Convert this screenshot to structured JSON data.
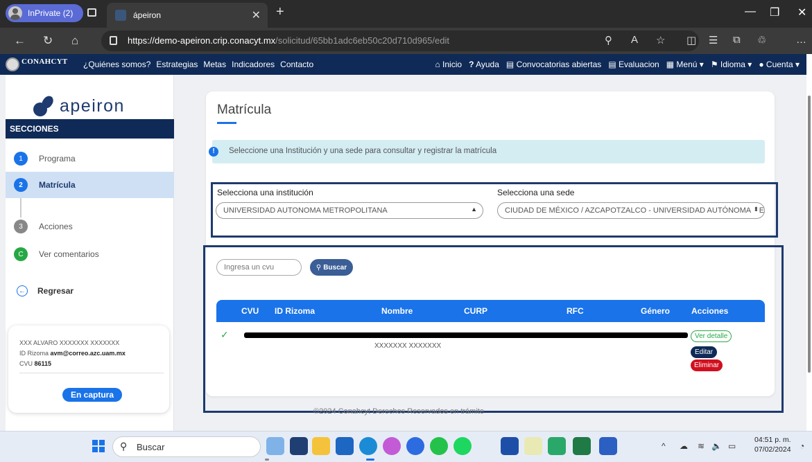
{
  "browser": {
    "inprivate_label": "InPrivate (2)",
    "tab_title": "ápeiron",
    "url_host": "https://demo-apeiron.crip.conacyt.mx",
    "url_path": "/solicitud/65bb1adc6eb50c20d710d965/edit"
  },
  "site_nav": {
    "logo_text": "CONAHCYT",
    "links": [
      "¿Quiénes somos?",
      "Estrategias",
      "Metas",
      "Indicadores",
      "Contacto"
    ],
    "right": [
      "Inicio",
      "Ayuda",
      "Convocatorias abiertas",
      "Evaluacion",
      "Menú",
      "Idioma",
      "Cuenta"
    ]
  },
  "sidebar": {
    "brand": "apeiron",
    "section_header": "SECCIONES",
    "steps": [
      {
        "num": "1",
        "label": "Programa"
      },
      {
        "num": "2",
        "label": "Matrícula"
      },
      {
        "num": "3",
        "label": "Acciones"
      },
      {
        "num": "C",
        "label": "Ver comentarios"
      }
    ],
    "back_label": "Regresar",
    "user": {
      "name": "XXX ALVARO XXXXXXX XXXXXXX",
      "rizoma_label": "ID Rizoma",
      "rizoma_value": "avm@correo.azc.uam.mx",
      "cvu_label": "CVU",
      "cvu_value": "86115",
      "status": "En captura"
    }
  },
  "main": {
    "title": "Matrícula",
    "alert": "Seleccione una Institución y una sede para consultar y registrar la matrícula",
    "institution_label": "Selecciona una institución",
    "institution_value": "UNIVERSIDAD AUTONOMA METROPOLITANA",
    "sede_label": "Selecciona una sede",
    "sede_value": "CIUDAD DE MÉXICO / AZCAPOTZALCO - UNIVERSIDAD AUTÓNOMA METROPOLITANA",
    "cvu_placeholder": "Ingresa un cvu",
    "search_label": "Buscar",
    "table_headers": [
      "CVU",
      "ID Rizoma",
      "Nombre",
      "CURP",
      "RFC",
      "Género",
      "Acciones"
    ],
    "row": {
      "name_line2": "XXXXXXX XXXXXXX",
      "btn_detail": "Ver detalle",
      "btn_edit": "Editar",
      "btn_delete": "Eliminar"
    },
    "footer": "©2024 Conahcyt Derechos Reservados en trámite"
  },
  "taskbar": {
    "search": "Buscar",
    "time": "04:51 p. m.",
    "date": "07/02/2024"
  }
}
